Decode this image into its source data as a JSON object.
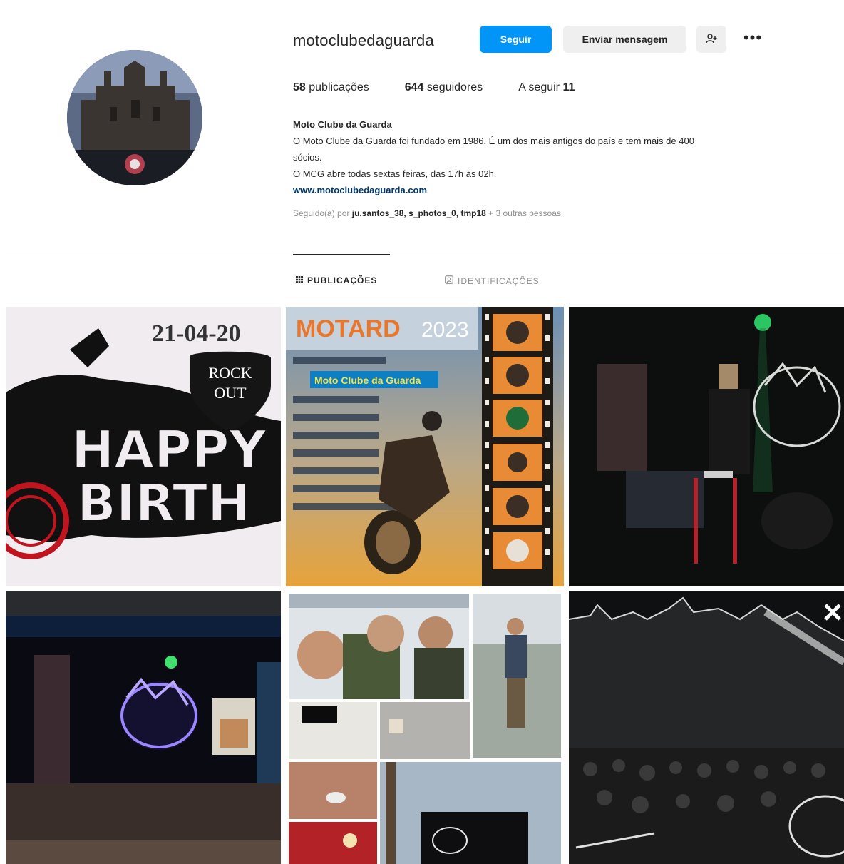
{
  "profile": {
    "username": "motoclubedaguarda",
    "follow_label": "Seguir",
    "message_label": "Enviar mensagem",
    "suggest_icon": "add-person-icon",
    "more_icon": "more-dots-icon",
    "stats": {
      "posts_count": "58",
      "posts_label": "publicações",
      "followers_count": "644",
      "followers_label": "seguidores",
      "following_label": "A seguir",
      "following_count": "11"
    },
    "bio": {
      "name": "Moto Clube da Guarda",
      "line1": "O Moto Clube da Guarda foi fundado em 1986. É um dos mais antigos do país e tem mais de 400",
      "line2": "sócios.",
      "line3": "O MCG abre todas sextas feiras, das 17h às 02h.",
      "link": "www.motoclubedaguarda.com"
    },
    "followed_by": {
      "prefix": "Seguido(a) por",
      "users": "ju.santos_38, s_photos_0, tmp18",
      "suffix": "+ 3 outras pessoas"
    }
  },
  "tabs": [
    {
      "label": "PUBLICAÇÕES",
      "icon": "grid-icon",
      "active": true
    },
    {
      "label": "IDENTIFICAÇÕES",
      "icon": "tag-icon",
      "active": false
    }
  ],
  "posts": {
    "post1": {
      "date": "21-04-20",
      "badge_top": "ROCK",
      "badge_bottom": "OUT",
      "big_line1": "HAPPY",
      "big_line2": "BIRTH"
    },
    "post2": {
      "title": "MOTARD",
      "year": "2023",
      "highlight": "Moto Clube da Guarda"
    },
    "post3": {},
    "post4": {},
    "post5": {},
    "post6": {}
  },
  "colors": {
    "accent": "#0095f6",
    "link": "#00376b",
    "muted": "#8e8e8e"
  }
}
